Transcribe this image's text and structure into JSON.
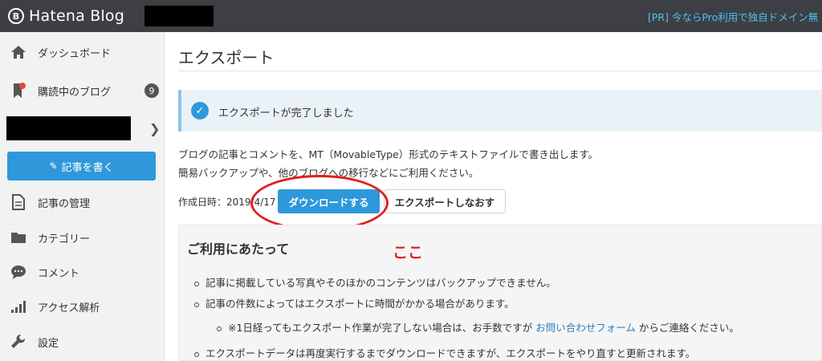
{
  "header": {
    "logo_mark": "B",
    "logo_text": "Hatena Blog",
    "pr_link": "[PR] 今ならPro利用で独自ドメイン無"
  },
  "sidebar": {
    "items": [
      {
        "label": "ダッシュボード",
        "icon": "home-icon"
      },
      {
        "label": "購読中のブログ",
        "icon": "bookmark-icon",
        "badge": "9"
      },
      {
        "label": "記事の管理",
        "icon": "document-icon"
      },
      {
        "label": "カテゴリー",
        "icon": "folder-icon"
      },
      {
        "label": "コメント",
        "icon": "comment-icon"
      },
      {
        "label": "アクセス解析",
        "icon": "bar-chart-icon"
      },
      {
        "label": "設定",
        "icon": "wrench-icon"
      }
    ],
    "write_button": "記事を書く"
  },
  "main": {
    "title": "エクスポート",
    "success_message": "エクスポートが完了しました",
    "description_line1": "ブログの記事とコメントを、MT（MovableType）形式のテキストファイルで書き出します。",
    "description_line2": "簡易バックアップや、他のブログへの移行などにご利用ください。",
    "created_label": "作成日時：2019/4/17",
    "download_button": "ダウンロードする",
    "reexport_button": "エクスポートしなおす",
    "annotation": "ここ",
    "notice": {
      "title": "ご利用にあたって",
      "bullet1": "記事に掲載している写真やそのほかのコンテンツはバックアップできません。",
      "bullet2": "記事の件数によってはエクスポートに時間がかかる場合があります。",
      "sub_bullet_prefix": "※1日経ってもエクスポート作業が完了しない場合は、お手数ですが",
      "sub_bullet_link": "お問い合わせフォーム",
      "sub_bullet_suffix": "からご連絡ください。",
      "bullet3": "エクスポートデータは再度実行するまでダウンロードできますが、エクスポートをやり直すと更新されます。"
    }
  },
  "colors": {
    "accent": "#2e98da",
    "topbar": "#3d3f44",
    "annotation": "#e02020"
  }
}
